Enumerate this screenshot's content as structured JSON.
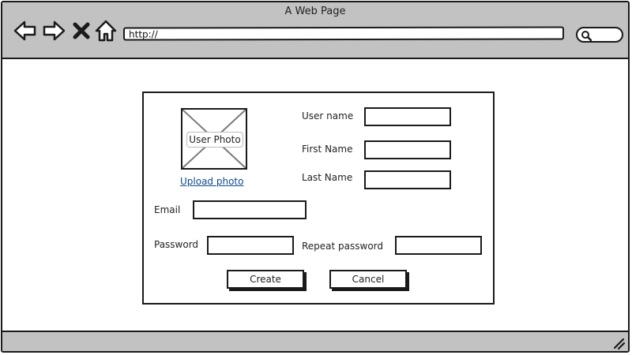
{
  "window": {
    "title": "A Web Page",
    "url": "http://"
  },
  "toolbar": {
    "icons": [
      "back-arrow-icon",
      "forward-arrow-icon",
      "close-x-icon",
      "home-icon",
      "search-icon"
    ]
  },
  "form": {
    "photo": {
      "placeholder_label": "User Photo",
      "upload_link": "Upload photo"
    },
    "fields": {
      "username_label": "User name",
      "first_name_label": "First Name",
      "last_name_label": "Last Name",
      "email_label": "Email",
      "password_label": "Password",
      "repeat_password_label": "Repeat password"
    },
    "values": {
      "username": "",
      "first_name": "",
      "last_name": "",
      "email": "",
      "password": "",
      "repeat_password": ""
    },
    "buttons": {
      "create": "Create",
      "cancel": "Cancel"
    }
  },
  "colors": {
    "chrome": "#c2c2c2",
    "outline": "#1a1a1a",
    "link": "#0b4a8f"
  }
}
